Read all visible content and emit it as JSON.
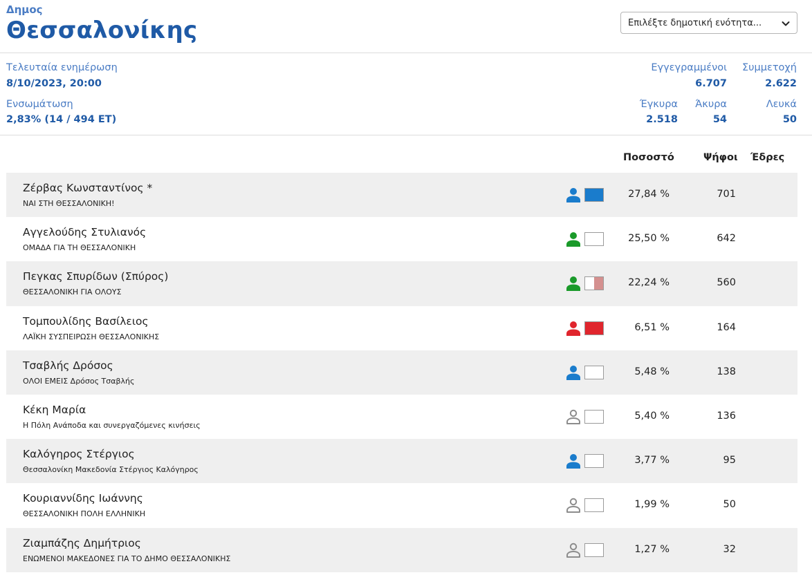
{
  "header": {
    "level": "Δημος",
    "name": "Θεσσαλονίκης",
    "select_label": "Επιλέξτε δημοτική ενότητα..."
  },
  "stats": {
    "updated_label": "Τελευταία ενημέρωση",
    "updated_value": "8/10/2023, 20:00",
    "incorporation_label": "Ενσωμάτωση",
    "incorporation_value": "2,83% (14 / 494 ΕΤ)",
    "registered_label": "Εγγεγραμμένοι",
    "registered_value": "6.707",
    "turnout_label": "Συμμετοχή",
    "turnout_value": "2.622",
    "valid_label": "Έγκυρα",
    "valid_value": "2.518",
    "invalid_label": "Άκυρα",
    "invalid_value": "54",
    "blank_label": "Λευκά",
    "blank_value": "50"
  },
  "table": {
    "col_pct": "Ποσοστό",
    "col_votes": "Ψήφοι",
    "col_seats": "Έδρες"
  },
  "colors": {
    "blue": "#1a7ccc",
    "green": "#1a9a2a",
    "red": "#e0252d",
    "grey": "#8c8c8c",
    "pink": "#d4908f"
  },
  "candidates": [
    {
      "name": "Ζέρβας Κωνσταντίνος *",
      "party": "ΝΑΙ ΣΤΗ ΘΕΣΣΑΛΟΝΙΚΗ!",
      "pct": "27,84 %",
      "votes": "701",
      "icon_color": "#1a7ccc",
      "icon_style": "filled",
      "swatch": [
        "#1a7ccc"
      ]
    },
    {
      "name": "Αγγελούδης Στυλιανός",
      "party": "ΟΜΑΔΑ ΓΙΑ ΤΗ ΘΕΣΣΑΛΟΝΙΚΗ",
      "pct": "25,50 %",
      "votes": "642",
      "icon_color": "#1a9a2a",
      "icon_style": "filled",
      "swatch": [
        "#ffffff"
      ]
    },
    {
      "name": "Πεγκας Σπυρίδων (Σπύρος)",
      "party": "ΘΕΣΣΑΛΟΝΙΚΗ ΓΙΑ ΟΛΟΥΣ",
      "pct": "22,24 %",
      "votes": "560",
      "icon_color": "#1a9a2a",
      "icon_style": "filled",
      "swatch": [
        "#ffffff",
        "#d4908f"
      ]
    },
    {
      "name": "Τομπουλίδης Βασίλειος",
      "party": "ΛΑΪΚΗ ΣΥΣΠΕΙΡΩΣΗ ΘΕΣΣΑΛΟΝΙΚΗΣ",
      "pct": "6,51 %",
      "votes": "164",
      "icon_color": "#e0252d",
      "icon_style": "filled",
      "swatch": [
        "#e0252d"
      ]
    },
    {
      "name": "Τσαβλής Δρόσος",
      "party": "ΟΛΟΙ ΕΜΕΙΣ Δρόσος Τσαβλής",
      "pct": "5,48 %",
      "votes": "138",
      "icon_color": "#1a7ccc",
      "icon_style": "filled",
      "swatch": [
        "#ffffff"
      ]
    },
    {
      "name": "Κέκη Μαρία",
      "party": "Η Πόλη Ανάποδα και συνεργαζόμενες κινήσεις",
      "pct": "5,40 %",
      "votes": "136",
      "icon_color": "#8c8c8c",
      "icon_style": "outline",
      "swatch": [
        "#ffffff"
      ]
    },
    {
      "name": "Καλόγηρος Στέργιος",
      "party": "Θεσσαλονίκη Μακεδονία Στέργιος Καλόγηρος",
      "pct": "3,77 %",
      "votes": "95",
      "icon_color": "#1a7ccc",
      "icon_style": "filled",
      "swatch": [
        "#ffffff"
      ]
    },
    {
      "name": "Κουριαννίδης Ιωάννης",
      "party": "ΘΕΣΣΑΛΟΝΙΚΗ ΠΟΛΗ ΕΛΛΗΝΙΚΗ",
      "pct": "1,99 %",
      "votes": "50",
      "icon_color": "#8c8c8c",
      "icon_style": "outline",
      "swatch": [
        "#ffffff"
      ]
    },
    {
      "name": "Ζιαμπάζης Δημήτριος",
      "party": "ΕΝΩΜΕΝΟΙ ΜΑΚΕΔΟΝΕΣ ΓΙΑ ΤΟ ΔΗΜΟ ΘΕΣΣΑΛΟΝΙΚΗΣ",
      "pct": "1,27 %",
      "votes": "32",
      "icon_color": "#8c8c8c",
      "icon_style": "outline",
      "swatch": [
        "#ffffff"
      ]
    }
  ]
}
